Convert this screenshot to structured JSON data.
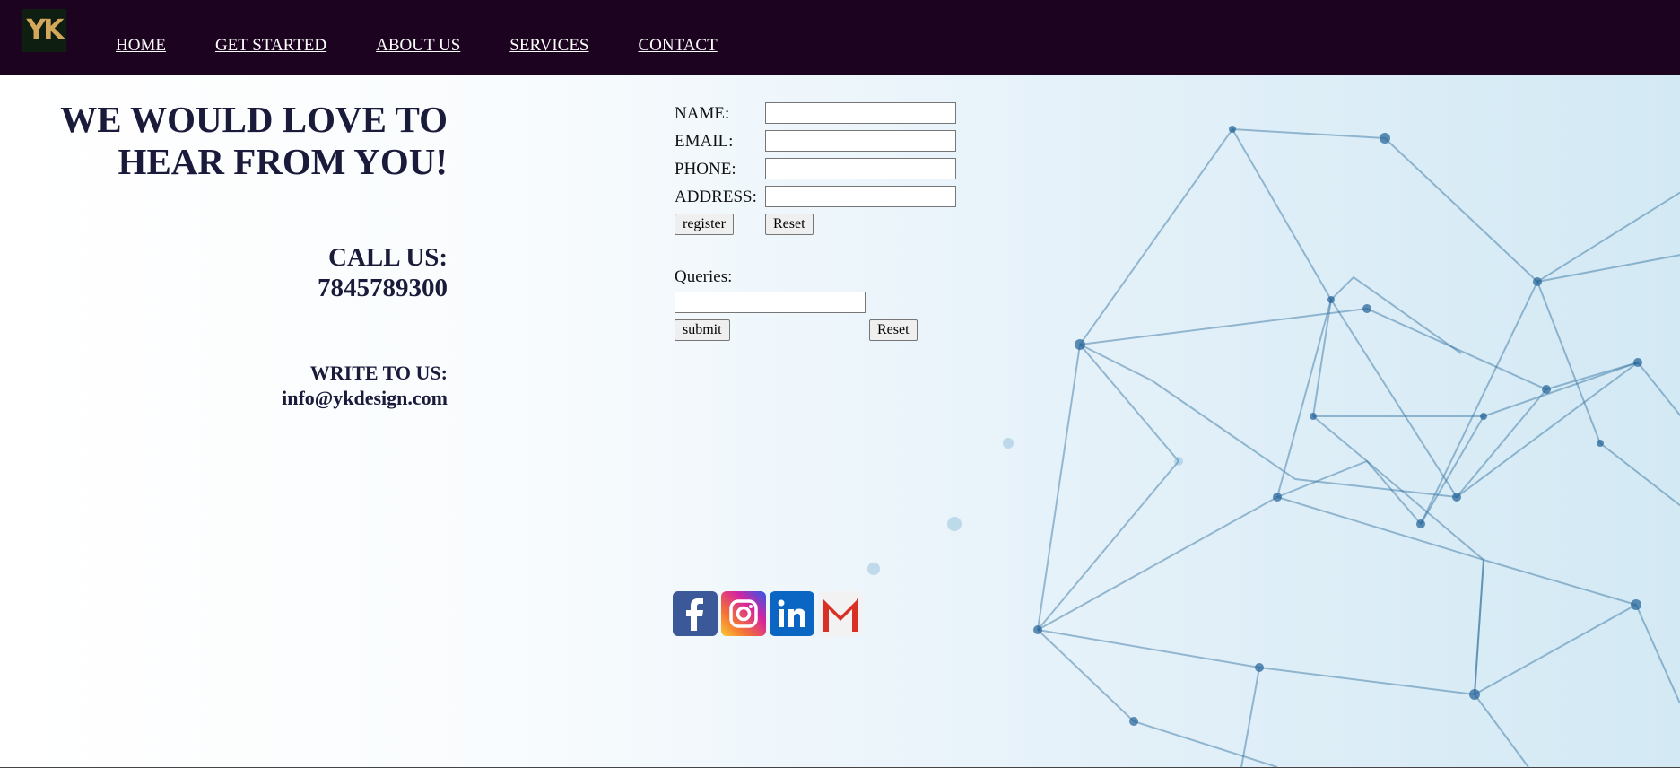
{
  "nav": {
    "logo_text": "YK",
    "links": [
      "HOME",
      "GET STARTED",
      "ABOUT US",
      "SERVICES",
      "CONTACT"
    ]
  },
  "contact": {
    "headline_line1": "WE WOULD LOVE TO",
    "headline_line2": "HEAR FROM YOU!",
    "call_label": "CALL US:",
    "phone": "7845789300",
    "write_label": "WRITE TO US:",
    "email": "info@ykdesign.com"
  },
  "register_form": {
    "name_label": "NAME:",
    "email_label": "EMAIL:",
    "phone_label": "PHONE:",
    "address_label": "ADDRESS:",
    "register_button": "register",
    "reset_button": "Reset"
  },
  "queries_form": {
    "queries_label": "Queries:",
    "submit_button": "submit",
    "reset_button": "Reset"
  },
  "social": {
    "icons": [
      "facebook-icon",
      "instagram-icon",
      "linkedin-icon",
      "gmail-icon"
    ],
    "colors": {
      "facebook": "#3b5998",
      "linkedin": "#0a66c2",
      "gmail": "#d93025"
    }
  },
  "theme": {
    "navbar_bg": "#1c0420",
    "logo_color": "#d4a85a",
    "heading_color": "#1a1a3a"
  }
}
